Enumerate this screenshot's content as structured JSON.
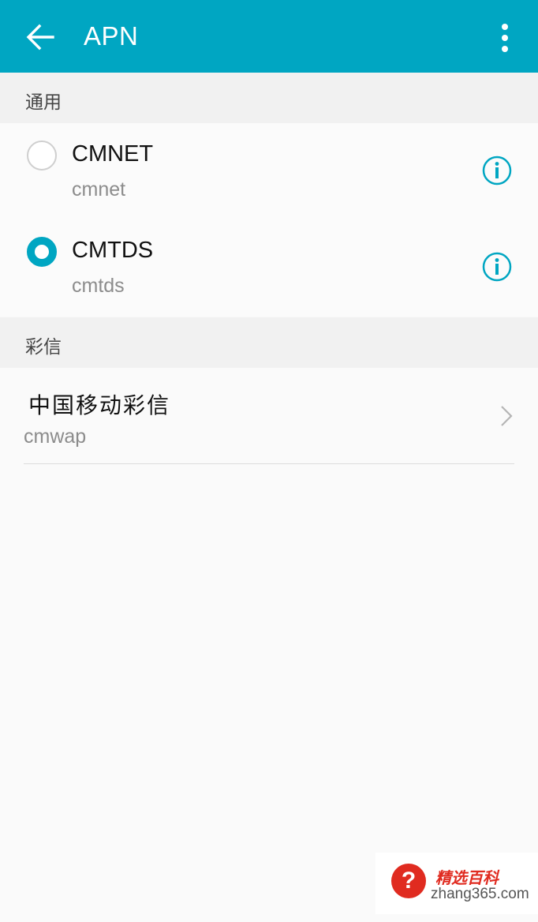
{
  "header": {
    "title": "APN",
    "back_icon": "arrow-left-icon",
    "menu_icon": "more-vert-icon",
    "accent_color": "#00a6c2"
  },
  "sections": {
    "general": {
      "title": "通用",
      "items": [
        {
          "name": "CMNET",
          "apn": "cmnet",
          "selected": false
        },
        {
          "name": "CMTDS",
          "apn": "cmtds",
          "selected": true
        }
      ]
    },
    "mms": {
      "title": "彩信",
      "item": {
        "name": "中国移动彩信",
        "apn": "cmwap"
      }
    }
  },
  "watermark": {
    "icon_text": "?",
    "title": "精选百科",
    "url": "zhang365.com"
  }
}
